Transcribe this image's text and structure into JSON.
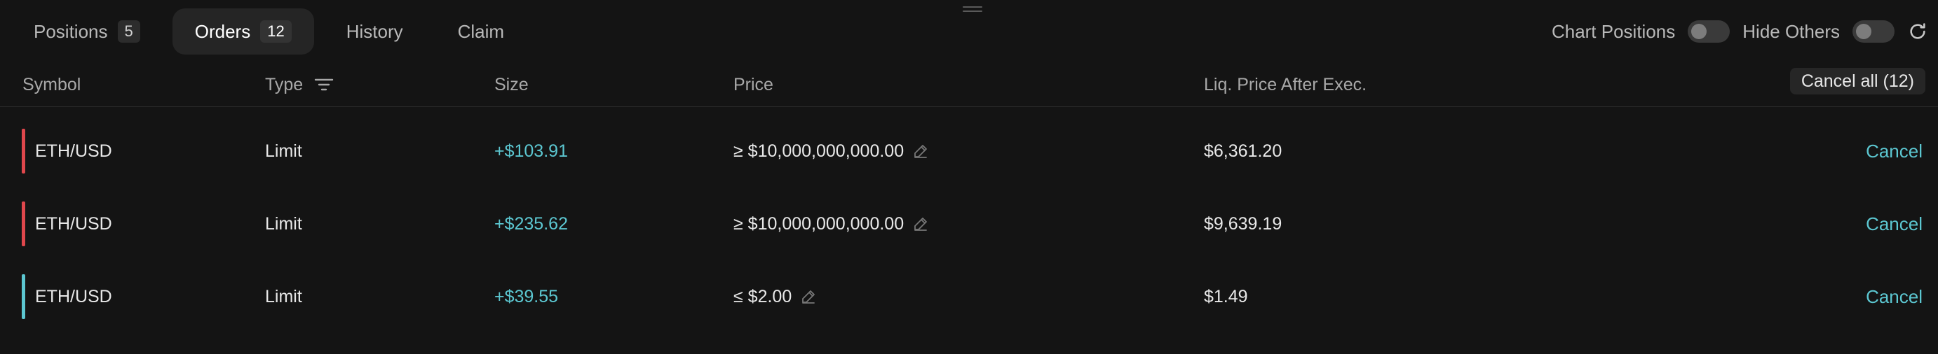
{
  "tabs": [
    {
      "label": "Positions",
      "count": "5",
      "active": false
    },
    {
      "label": "Orders",
      "count": "12",
      "active": true
    },
    {
      "label": "History",
      "count": null,
      "active": false
    },
    {
      "label": "Claim",
      "count": null,
      "active": false
    }
  ],
  "toggles": {
    "chart_positions": {
      "label": "Chart Positions",
      "on": false
    },
    "hide_others": {
      "label": "Hide Others",
      "on": false
    }
  },
  "table": {
    "headers": {
      "symbol": "Symbol",
      "type": "Type",
      "size": "Size",
      "price": "Price",
      "liq_price": "Liq. Price After Exec."
    },
    "cancel_all": "Cancel all (12)",
    "rows": [
      {
        "side_color": "#e0474c",
        "symbol": "ETH/USD",
        "type": "Limit",
        "size": "+$103.91",
        "price": "≥ $10,000,000,000.00",
        "liq_price": "$6,361.20",
        "action": "Cancel"
      },
      {
        "side_color": "#e0474c",
        "symbol": "ETH/USD",
        "type": "Limit",
        "size": "+$235.62",
        "price": "≥ $10,000,000,000.00",
        "liq_price": "$9,639.19",
        "action": "Cancel"
      },
      {
        "side_color": "#5cc7d1",
        "symbol": "ETH/USD",
        "type": "Limit",
        "size": "+$39.55",
        "price": "≤ $2.00",
        "liq_price": "$1.49",
        "action": "Cancel"
      }
    ]
  },
  "colors": {
    "background": "#141414",
    "accent": "#5cc7d1",
    "short": "#e0474c",
    "long": "#5cc7d1"
  },
  "icons": {
    "drag": "drag-handle-icon",
    "refresh": "refresh-icon",
    "filter": "filter-icon",
    "edit": "pencil-icon"
  }
}
